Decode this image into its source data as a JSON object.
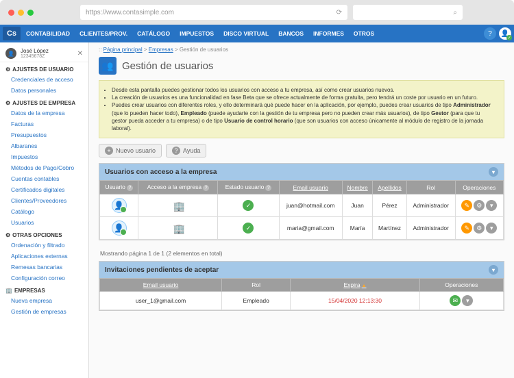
{
  "browser": {
    "url": "https://www.contasimple.com"
  },
  "nav": {
    "logo": "Cs",
    "items": [
      "CONTABILIDAD",
      "CLIENTES/PROV.",
      "CATÁLOGO",
      "IMPUESTOS",
      "DISCO VIRTUAL",
      "BANCOS",
      "INFORMES",
      "OTROS"
    ]
  },
  "user": {
    "name": "José López",
    "id": "12345678Z"
  },
  "sidebar": {
    "s1": {
      "title": "AJUSTES DE USUARIO",
      "items": [
        "Credenciales de acceso",
        "Datos personales"
      ]
    },
    "s2": {
      "title": "AJUSTES DE EMPRESA",
      "items": [
        "Datos de la empresa",
        "Facturas",
        "Presupuestos",
        "Albaranes",
        "Impuestos",
        "Métodos de Pago/Cobro",
        "Cuentas contables",
        "Certificados digitales",
        "Clientes/Proveedores",
        "Catálogo",
        "Usuarios"
      ]
    },
    "s3": {
      "title": "OTRAS OPCIONES",
      "items": [
        "Ordenación y filtrado",
        "Aplicaciones externas",
        "Remesas bancarias",
        "Configuración correo"
      ]
    },
    "s4": {
      "title": "EMPRESAS",
      "items": [
        "Nueva empresa",
        "Gestión de empresas"
      ]
    }
  },
  "crumb": {
    "home": "Página principal",
    "mid": "Empresas",
    "cur": "Gestión de usuarios"
  },
  "page": {
    "title": "Gestión de usuarios"
  },
  "info": {
    "l1": "Desde esta pantalla puedes gestionar todos los usuarios con acceso a tu empresa, así como crear usuarios nuevos.",
    "l2": "La creación de usuarios es una funcionalidad en fase Beta que se ofrece actualmente de forma gratuita, pero tendrá un coste por usuario en un futuro.",
    "l3a": "Puedes crear usuarios con diferentes roles, y ello determinará qué puede hacer en la aplicación, por ejemplo, puedes crear usuarios de tipo ",
    "l3b": "Administrador",
    "l3c": " (que lo pueden hacer todo), ",
    "l3d": "Empleado",
    "l3e": " (puede ayudarte con la gestión de tu empresa pero no pueden crear más usuarios), de tipo ",
    "l3f": "Gestor",
    "l3g": " (para que tu gestor pueda acceder a tu empresa) o de tipo ",
    "l3h": "Usuario de control horario",
    "l3i": " (que son usuarios con acceso únicamente al módulo de registro de la jornada laboral)."
  },
  "buttons": {
    "new": "Nuevo usuario",
    "help": "Ayuda"
  },
  "table1": {
    "title": "Usuarios con acceso a la empresa",
    "headers": {
      "user": "Usuario",
      "access": "Acceso a la empresa",
      "state": "Estado usuario",
      "email": "Email usuario",
      "name": "Nombre",
      "surname": "Apellidos",
      "role": "Rol",
      "ops": "Operaciones"
    },
    "rows": [
      {
        "email": "juan@hotmail.com",
        "name": "Juan",
        "surname": "Pérez",
        "role": "Administrador"
      },
      {
        "email": "maria@gmail.com",
        "name": "María",
        "surname": "Martínez",
        "role": "Administrador"
      }
    ],
    "pager": "Mostrando página 1 de 1 (2 elementos en total)"
  },
  "table2": {
    "title": "Invitaciones pendientes de aceptar",
    "headers": {
      "email": "Email usuario",
      "role": "Rol",
      "expire": "Expira",
      "ops": "Operaciones"
    },
    "rows": [
      {
        "email": "user_1@gmail.com",
        "role": "Empleado",
        "expire": "15/04/2020 12:13:30"
      }
    ]
  }
}
